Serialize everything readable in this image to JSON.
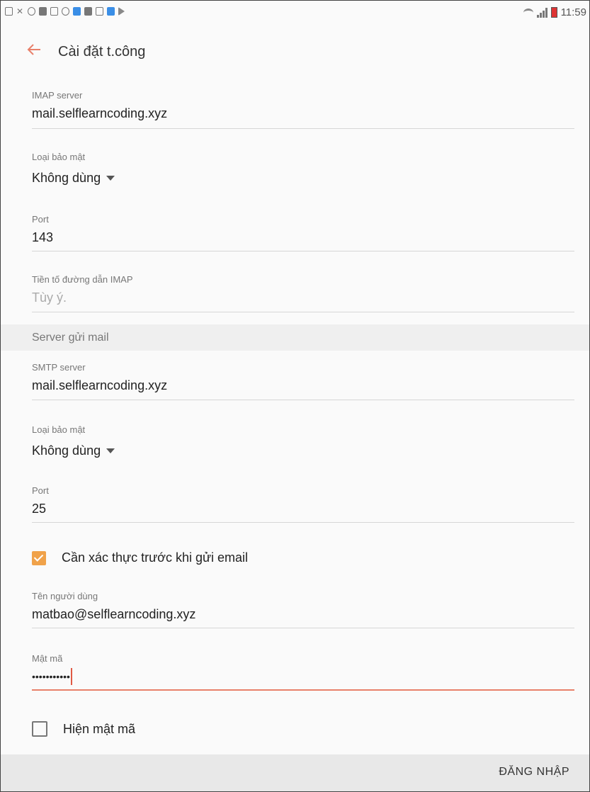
{
  "status_bar": {
    "time": "11:59",
    "notification_icons": [
      "screenshot-icon",
      "missed-call-icon",
      "clock-icon",
      "briefcase-icon",
      "image-icon",
      "link-icon",
      "calendar-icon",
      "email-icon",
      "mail-icon",
      "photos-icon",
      "play-store-icon"
    ]
  },
  "app_bar": {
    "title": "Cài đặt t.công"
  },
  "incoming": {
    "imap_server_label": "IMAP server",
    "imap_server_value": "mail.selflearncoding.xyz",
    "security_label": "Loại bảo mật",
    "security_value": "Không dùng",
    "port_label": "Port",
    "port_value": "143",
    "path_prefix_label": "Tiền tố đường dẫn IMAP",
    "path_prefix_placeholder": "Tùy ý."
  },
  "outgoing": {
    "section_title": "Server gửi mail",
    "smtp_server_label": "SMTP server",
    "smtp_server_value": "mail.selflearncoding.xyz",
    "security_label": "Loại bảo mật",
    "security_value": "Không dùng",
    "port_label": "Port",
    "port_value": "25",
    "require_auth_label": "Cần xác thực trước khi gửi email",
    "require_auth_checked": true,
    "username_label": "Tên người dùng",
    "username_value": "matbao@selflearncoding.xyz",
    "password_label": "Mật mã",
    "password_value": "•••••••••••",
    "show_password_label": "Hiện mật mã",
    "show_password_checked": false
  },
  "footer": {
    "login_label": "ĐĂNG NHẬP"
  },
  "colors": {
    "accent": "#e8806a",
    "checkbox": "#f0a24a",
    "section_bg": "#efefef",
    "footer_bg": "#e8e8e8"
  }
}
